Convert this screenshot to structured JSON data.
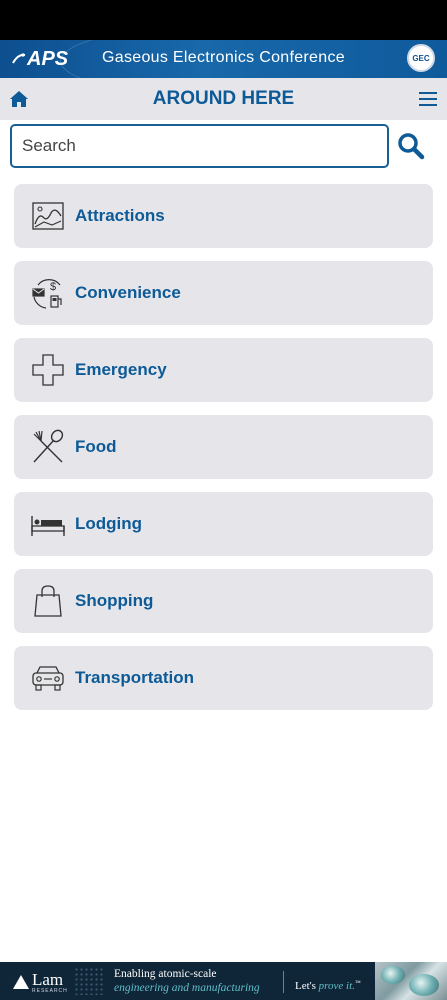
{
  "header": {
    "aps_logo_text": "APS",
    "conference_title": "Gaseous Electronics Conference",
    "gec_logo_text": "GEC"
  },
  "nav": {
    "title": "AROUND HERE"
  },
  "search": {
    "placeholder": "Search"
  },
  "categories": [
    {
      "label": "Attractions",
      "icon": "picture-frame-icon"
    },
    {
      "label": "Convenience",
      "icon": "convenience-services-icon"
    },
    {
      "label": "Emergency",
      "icon": "medical-cross-icon"
    },
    {
      "label": "Food",
      "icon": "fork-spoon-icon"
    },
    {
      "label": "Lodging",
      "icon": "bed-icon"
    },
    {
      "label": "Shopping",
      "icon": "shopping-bag-icon"
    },
    {
      "label": "Transportation",
      "icon": "car-icon"
    }
  ],
  "ad": {
    "brand": "Lam",
    "brand_sub": "RESEARCH",
    "line1": "Enabling atomic-scale",
    "line2": "engineering and manufacturing",
    "cta_prefix": "Let's ",
    "cta_emphasis": "prove it.",
    "cta_suffix": "™"
  },
  "colors": {
    "brand_blue": "#0d5a97",
    "banner_blue": "#0d4f8f",
    "tile_gray": "#e6e6ea",
    "ad_dark": "#0f2538",
    "ad_teal": "#5fc0c9"
  }
}
